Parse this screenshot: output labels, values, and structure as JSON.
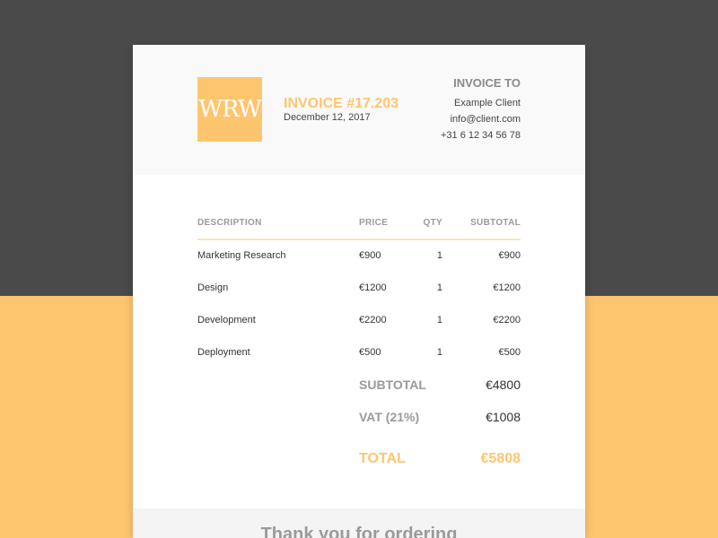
{
  "colors": {
    "accent": "#fec56f",
    "dark_background": "#4a4a4a",
    "muted_text": "#9a9a9a"
  },
  "invoice": {
    "logo_text": "WRW",
    "number": "INVOICE #17.203",
    "date": "December 12, 2017"
  },
  "invoice_to": {
    "title": "INVOICE TO",
    "client": "Example Client",
    "email": "info@client.com",
    "phone": "+31 6 12 34 56 78"
  },
  "table": {
    "headers": {
      "description": "DESCRIPTION",
      "price": "PRICE",
      "qty": "QTY",
      "subtotal": "SUBTOTAL"
    },
    "rows": [
      {
        "description": "Marketing Research",
        "price": "€900",
        "qty": "1",
        "subtotal": "€900"
      },
      {
        "description": "Design",
        "price": "€1200",
        "qty": "1",
        "subtotal": "€1200"
      },
      {
        "description": "Development",
        "price": "€2200",
        "qty": "1",
        "subtotal": "€2200"
      },
      {
        "description": "Deployment",
        "price": "€500",
        "qty": "1",
        "subtotal": "€500"
      }
    ]
  },
  "summary": {
    "subtotal_label": "SUBTOTAL",
    "subtotal_value": "€4800",
    "vat_label": "VAT (21%)",
    "vat_value": "€1008",
    "total_label": "TOTAL",
    "total_value": "€5808"
  },
  "footer": {
    "thanks": "Thank you for ordering"
  }
}
